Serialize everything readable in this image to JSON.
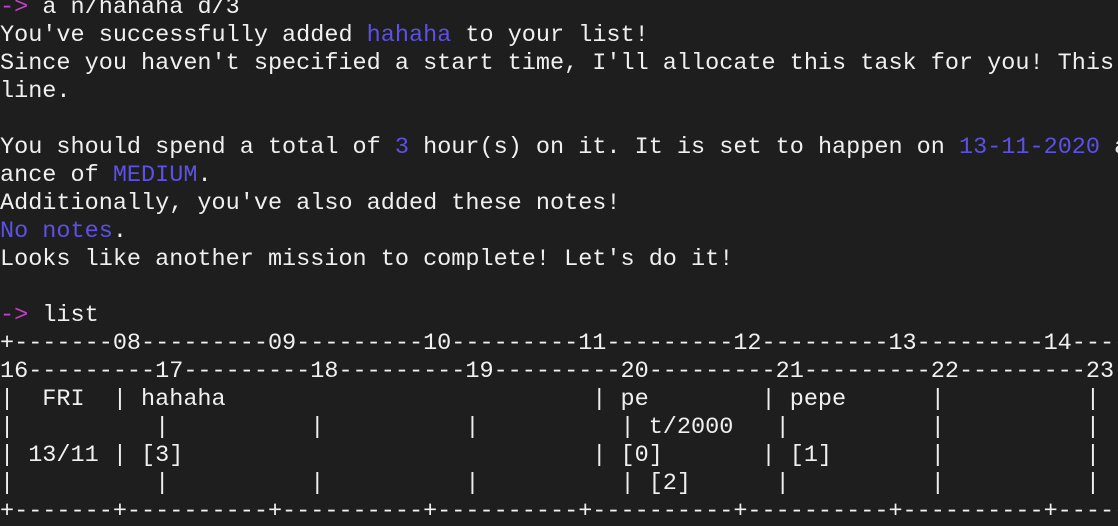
{
  "colors": {
    "background": "#1e1e1e",
    "text": "#f0f0f0",
    "prompt": "#c540c8",
    "highlight": "#5d50e6"
  },
  "terminal": {
    "lines": [
      {
        "role": "command",
        "segments": [
          {
            "text": "->",
            "color": "prompt"
          },
          {
            "text": " a n/hahaha d/3"
          }
        ]
      },
      {
        "role": "output",
        "segments": [
          {
            "text": "You've successfully added "
          },
          {
            "text": "hahaha",
            "color": "highlight"
          },
          {
            "text": " to your list!"
          }
        ]
      },
      {
        "role": "output",
        "segments": [
          {
            "text": "Since you haven't specified a start time, I'll allocate this task for you! This"
          }
        ]
      },
      {
        "role": "output",
        "segments": [
          {
            "text": "line."
          }
        ]
      },
      {
        "role": "blank",
        "segments": [
          {
            "text": ""
          }
        ]
      },
      {
        "role": "output",
        "segments": [
          {
            "text": "You should spend a total of "
          },
          {
            "text": "3",
            "color": "highlight"
          },
          {
            "text": " hour(s) on it. It is set to happen on "
          },
          {
            "text": "13-11-2020",
            "color": "highlight"
          },
          {
            "text": " a"
          }
        ]
      },
      {
        "role": "output",
        "segments": [
          {
            "text": "ance of "
          },
          {
            "text": "MEDIUM",
            "color": "highlight"
          },
          {
            "text": "."
          }
        ]
      },
      {
        "role": "output",
        "segments": [
          {
            "text": "Additionally, you've also added these notes!"
          }
        ]
      },
      {
        "role": "output",
        "segments": [
          {
            "text": "No notes",
            "color": "highlight"
          },
          {
            "text": "."
          }
        ]
      },
      {
        "role": "output",
        "segments": [
          {
            "text": "Looks like another mission to complete! Let's do it!"
          }
        ]
      },
      {
        "role": "blank",
        "segments": [
          {
            "text": ""
          }
        ]
      },
      {
        "role": "command",
        "segments": [
          {
            "text": "->",
            "color": "prompt"
          },
          {
            "text": " list"
          }
        ]
      },
      {
        "role": "table",
        "segments": [
          {
            "text": "+-------08---------09---------10---------11---------12---------13---------14----"
          }
        ]
      },
      {
        "role": "table",
        "segments": [
          {
            "text": "16---------17---------18---------19---------20---------21---------22---------23-"
          }
        ]
      },
      {
        "role": "table",
        "segments": [
          {
            "text": "|  FRI  | hahaha                          | pe        | pepe      |          |     "
          }
        ]
      },
      {
        "role": "table",
        "segments": [
          {
            "text": "|          |          |          |          | t/2000   |          |          |  "
          }
        ]
      },
      {
        "role": "table",
        "segments": [
          {
            "text": "| 13/11 | [3]                             | [0]       | [1]       |          |     "
          }
        ]
      },
      {
        "role": "table",
        "segments": [
          {
            "text": "|          |          |          |          | [2]      |          |          |  "
          }
        ]
      },
      {
        "role": "table",
        "segments": [
          {
            "text": "+-------+----------+----------+----------+----------+----------+----------+-----"
          }
        ]
      }
    ]
  }
}
